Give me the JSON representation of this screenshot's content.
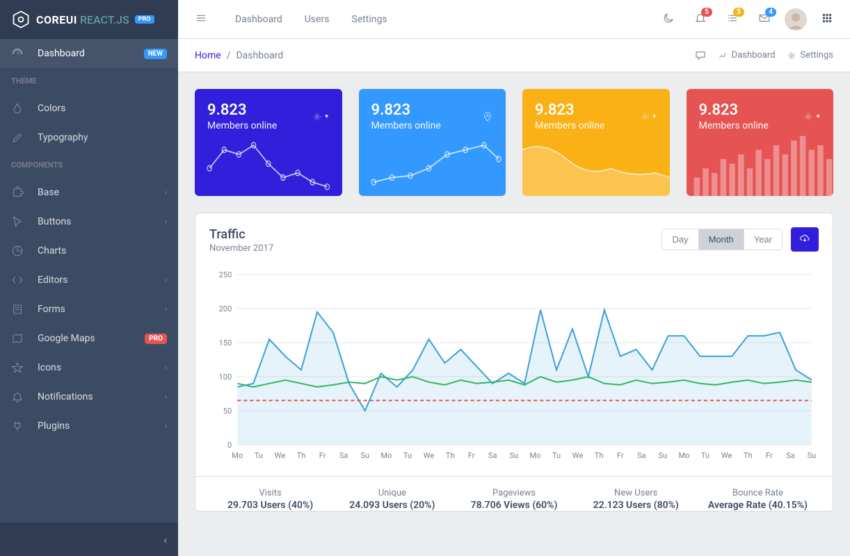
{
  "brand": {
    "name": "COREUI",
    "sub": "REACT.JS",
    "tag": "PRO"
  },
  "sidebar": {
    "dashboard": "Dashboard",
    "badge_new": "NEW",
    "title_theme": "THEME",
    "colors": "Colors",
    "typography": "Typography",
    "title_components": "COMPONENTS",
    "base": "Base",
    "buttons": "Buttons",
    "charts": "Charts",
    "editors": "Editors",
    "forms": "Forms",
    "gmaps": "Google Maps",
    "badge_pro": "PRO",
    "icons": "Icons",
    "notifications": "Notifications",
    "plugins": "Plugins"
  },
  "header": {
    "nav": {
      "dashboard": "Dashboard",
      "users": "Users",
      "settings": "Settings"
    },
    "badges": {
      "bell": "5",
      "list": "5",
      "mail": "4"
    }
  },
  "subheader": {
    "home": "Home",
    "sep": "/",
    "active": "Dashboard",
    "link_dashboard": "Dashboard",
    "link_settings": "Settings"
  },
  "widgets": [
    {
      "value": "9.823",
      "label": "Members online"
    },
    {
      "value": "9.823",
      "label": "Members online"
    },
    {
      "value": "9.823",
      "label": "Members online"
    },
    {
      "value": "9.823",
      "label": "Members online"
    }
  ],
  "traffic": {
    "title": "Traffic",
    "subtitle": "November 2017",
    "btn_day": "Day",
    "btn_month": "Month",
    "btn_year": "Year"
  },
  "chart_data": {
    "type": "line",
    "xlabel": "",
    "ylabel": "",
    "ylim": [
      0,
      250
    ],
    "categories": [
      "Mo",
      "Tu",
      "We",
      "Th",
      "Fr",
      "Sa",
      "Su",
      "Mo",
      "Tu",
      "We",
      "Th",
      "Fr",
      "Sa",
      "Su",
      "Mo",
      "Tu",
      "We",
      "Th",
      "Fr",
      "Sa",
      "Su",
      "Mo",
      "Tu",
      "We",
      "Th",
      "Fr",
      "Sa",
      "Su"
    ],
    "series": [
      {
        "name": "series1",
        "color": "#39a0d8",
        "values": [
          85,
          90,
          155,
          130,
          110,
          195,
          165,
          90,
          50,
          105,
          85,
          110,
          155,
          120,
          140,
          115,
          90,
          105,
          90,
          198,
          110,
          170,
          100,
          198,
          130,
          140,
          110,
          160,
          160,
          130,
          130,
          130,
          160,
          160,
          165,
          110,
          95
        ]
      },
      {
        "name": "series2",
        "color": "#2eb85c",
        "values": [
          90,
          85,
          90,
          95,
          90,
          85,
          88,
          92,
          90,
          100,
          95,
          100,
          92,
          88,
          95,
          90,
          92,
          95,
          88,
          100,
          92,
          95,
          100,
          90,
          88,
          95,
          90,
          92,
          95,
          90,
          88,
          92,
          95,
          90,
          92,
          95,
          92
        ]
      },
      {
        "name": "limit",
        "color": "#e55353",
        "dashed": true,
        "values": [
          65,
          65,
          65,
          65,
          65,
          65,
          65,
          65,
          65,
          65,
          65,
          65,
          65,
          65,
          65,
          65,
          65,
          65,
          65,
          65,
          65,
          65,
          65,
          65,
          65,
          65,
          65,
          65,
          65,
          65,
          65,
          65,
          65,
          65,
          65,
          65,
          65
        ]
      }
    ],
    "yticks": [
      0,
      50,
      100,
      150,
      200,
      250
    ]
  },
  "footer": [
    {
      "label": "Visits",
      "value": "29.703 Users (40%)"
    },
    {
      "label": "Unique",
      "value": "24.093 Users (20%)"
    },
    {
      "label": "Pageviews",
      "value": "78.706 Views (60%)"
    },
    {
      "label": "New Users",
      "value": "22.123 Users (80%)"
    },
    {
      "label": "Bounce Rate",
      "value": "Average Rate (40.15%)"
    }
  ]
}
